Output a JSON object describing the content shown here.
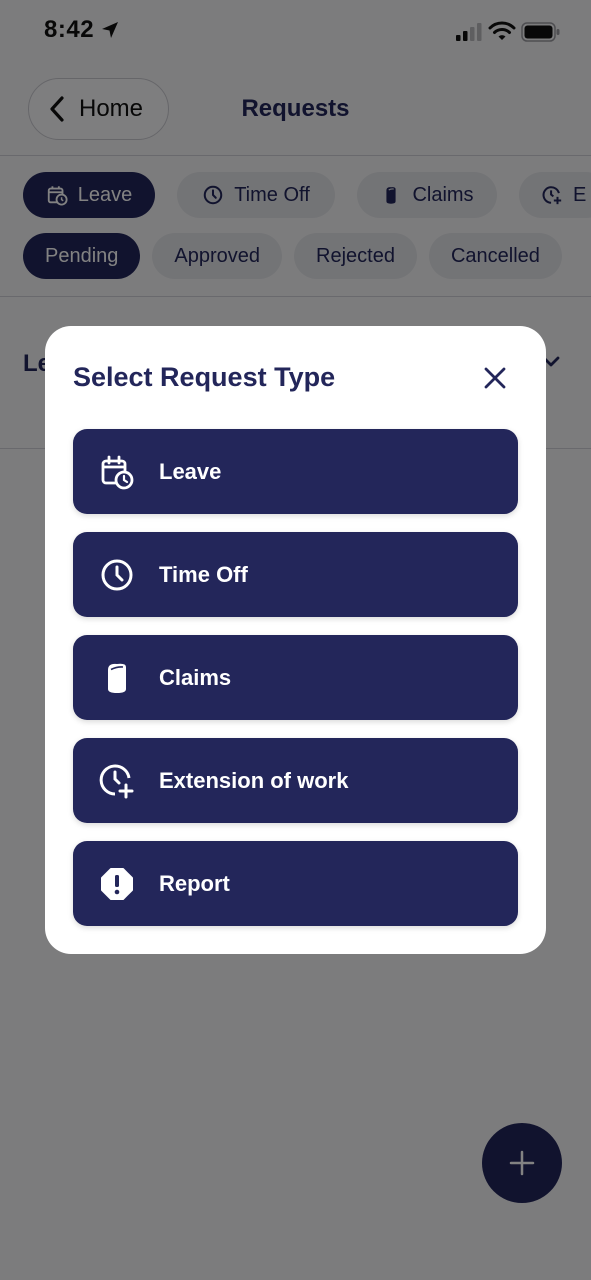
{
  "status_bar": {
    "time": "8:42"
  },
  "header": {
    "back_label": "Home",
    "title": "Requests"
  },
  "type_tabs": [
    {
      "label": "Leave",
      "icon": "calendar-clock-icon",
      "active": true
    },
    {
      "label": "Time Off",
      "icon": "clock-icon",
      "active": false
    },
    {
      "label": "Claims",
      "icon": "cylinder-icon",
      "active": false
    },
    {
      "label": "E",
      "icon": "clock-plus-icon",
      "active": false
    }
  ],
  "status_tabs": [
    {
      "label": "Pending",
      "active": true
    },
    {
      "label": "Approved",
      "active": false
    },
    {
      "label": "Rejected",
      "active": false
    },
    {
      "label": "Cancelled",
      "active": false
    }
  ],
  "list": {
    "partial_title": "Le"
  },
  "modal": {
    "title": "Select Request Type",
    "options": [
      {
        "label": "Leave",
        "icon": "calendar-clock-icon"
      },
      {
        "label": "Time Off",
        "icon": "clock-icon"
      },
      {
        "label": "Claims",
        "icon": "cylinder-icon"
      },
      {
        "label": "Extension of work",
        "icon": "clock-plus-icon"
      },
      {
        "label": "Report",
        "icon": "alert-octagon-icon"
      }
    ]
  },
  "colors": {
    "primary": "#23265a",
    "chip_inactive": "#e2e3e8",
    "background": "#f4f4f6",
    "overlay": "rgba(0,0,0,0.49)"
  }
}
